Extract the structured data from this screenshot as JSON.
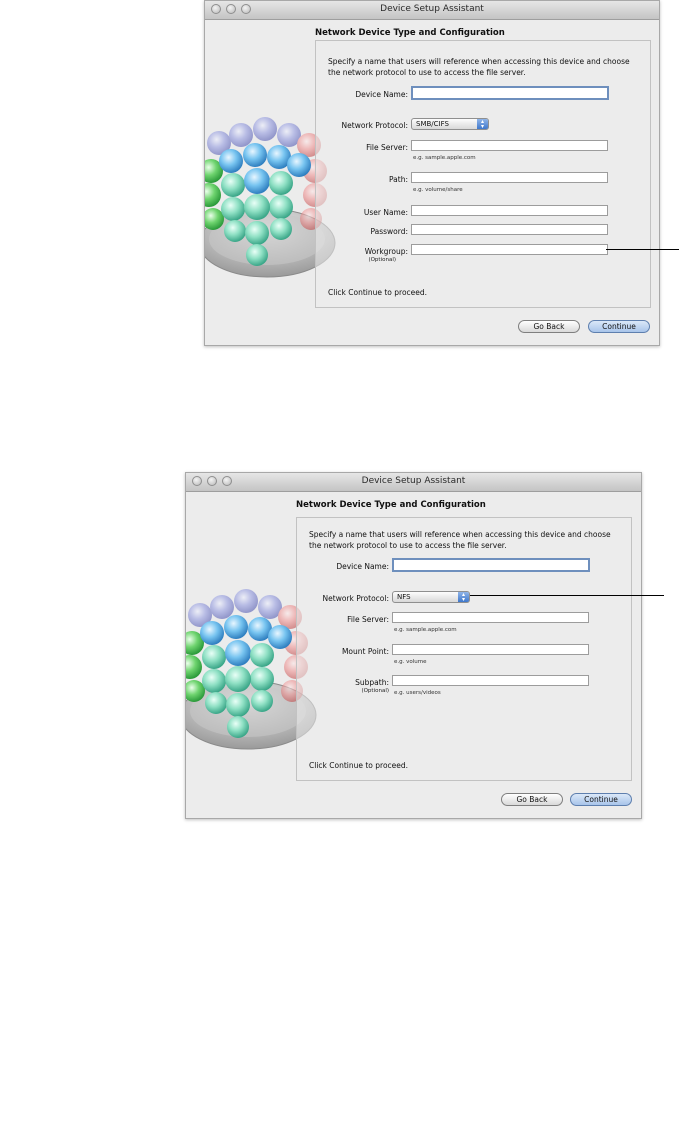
{
  "window_title": "Device Setup Assistant",
  "heading": "Network Device Type and Configuration",
  "description": "Specify a name that users will reference when accessing this device and choose the network protocol to use to access the file server.",
  "proceed_text": "Click Continue to proceed.",
  "buttons": {
    "go_back": "Go Back",
    "continue": "Continue"
  },
  "dialog_smb": {
    "device_name_label": "Device Name:",
    "protocol_label": "Network Protocol:",
    "protocol_value": "SMB/CIFS",
    "file_server_label": "File Server:",
    "file_server_hint": "e.g. sample.apple.com",
    "path_label": "Path:",
    "path_hint": "e.g. volume/share",
    "user_name_label": "User Name:",
    "password_label": "Password:",
    "workgroup_label": "Workgroup:",
    "workgroup_optional": "(Optional)"
  },
  "dialog_nfs": {
    "device_name_label": "Device Name:",
    "protocol_label": "Network Protocol:",
    "protocol_value": "NFS",
    "file_server_label": "File Server:",
    "file_server_hint": "e.g. sample.apple.com",
    "mount_point_label": "Mount Point:",
    "mount_point_hint": "e.g. volume",
    "subpath_label": "Subpath:",
    "subpath_optional": "(Optional)",
    "subpath_hint": "e.g. users/videos"
  },
  "colors": {
    "focus_ring": "#6e8fbd",
    "popup_arrow": "#3f78cc",
    "window_bg": "#ececec"
  }
}
